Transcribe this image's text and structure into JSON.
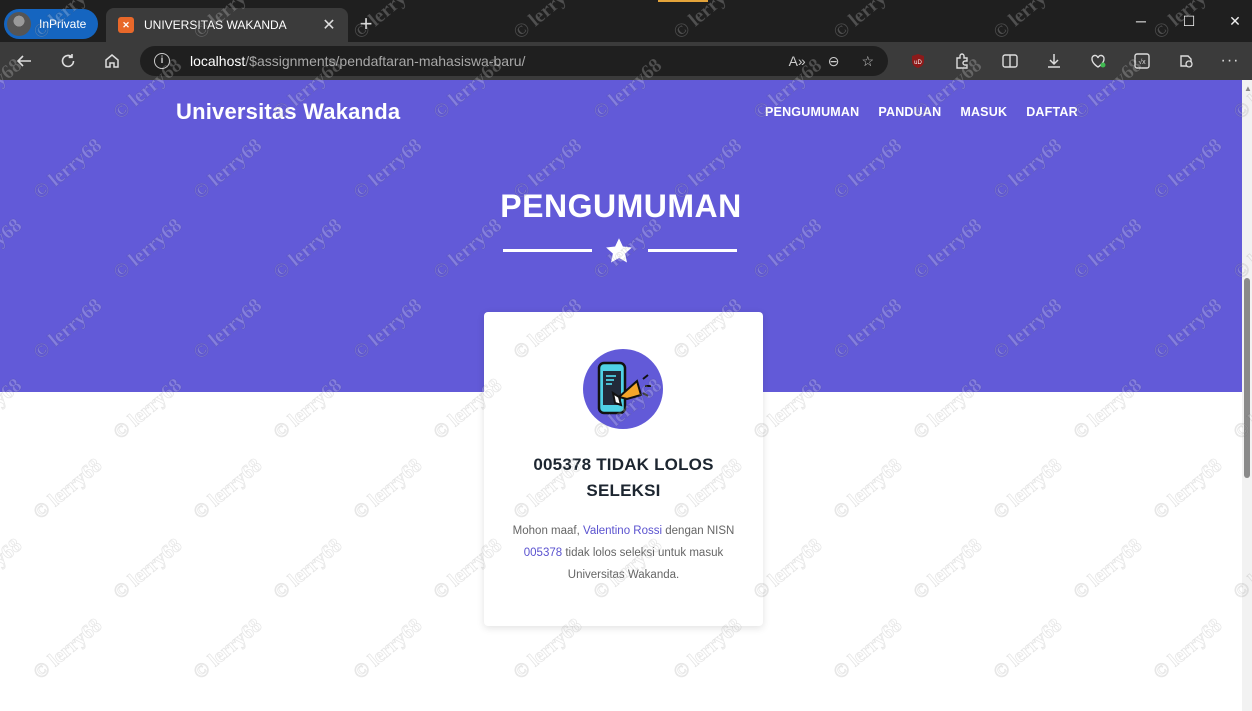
{
  "browser": {
    "inprivate_label": "InPrivate",
    "tab_title": "UNIVERSITAS WAKANDA",
    "url_host": "localhost",
    "url_path": "/$assignments/pendaftaran-mahasiswa-baru/"
  },
  "site": {
    "brand": "Universitas Wakanda",
    "nav": [
      "PENGUMUMAN",
      "PANDUAN",
      "MASUK",
      "DAFTAR"
    ],
    "hero_title": "PENGUMUMAN"
  },
  "card": {
    "title_line1": "005378 TIDAK LOLOS",
    "title_line2": "SELEKSI",
    "body_1": "Mohon maaf, ",
    "name": "Valentino Rossi",
    "body_2": " dengan NISN",
    "nisn": "005378",
    "body_3": " tidak lolos seleksi untuk masuk",
    "body_4": "Universitas Wakanda."
  },
  "watermark": "© lerry68",
  "colors": {
    "hero": "#625ad8",
    "link": "#5a52cf",
    "inprivate": "#1565c0"
  }
}
